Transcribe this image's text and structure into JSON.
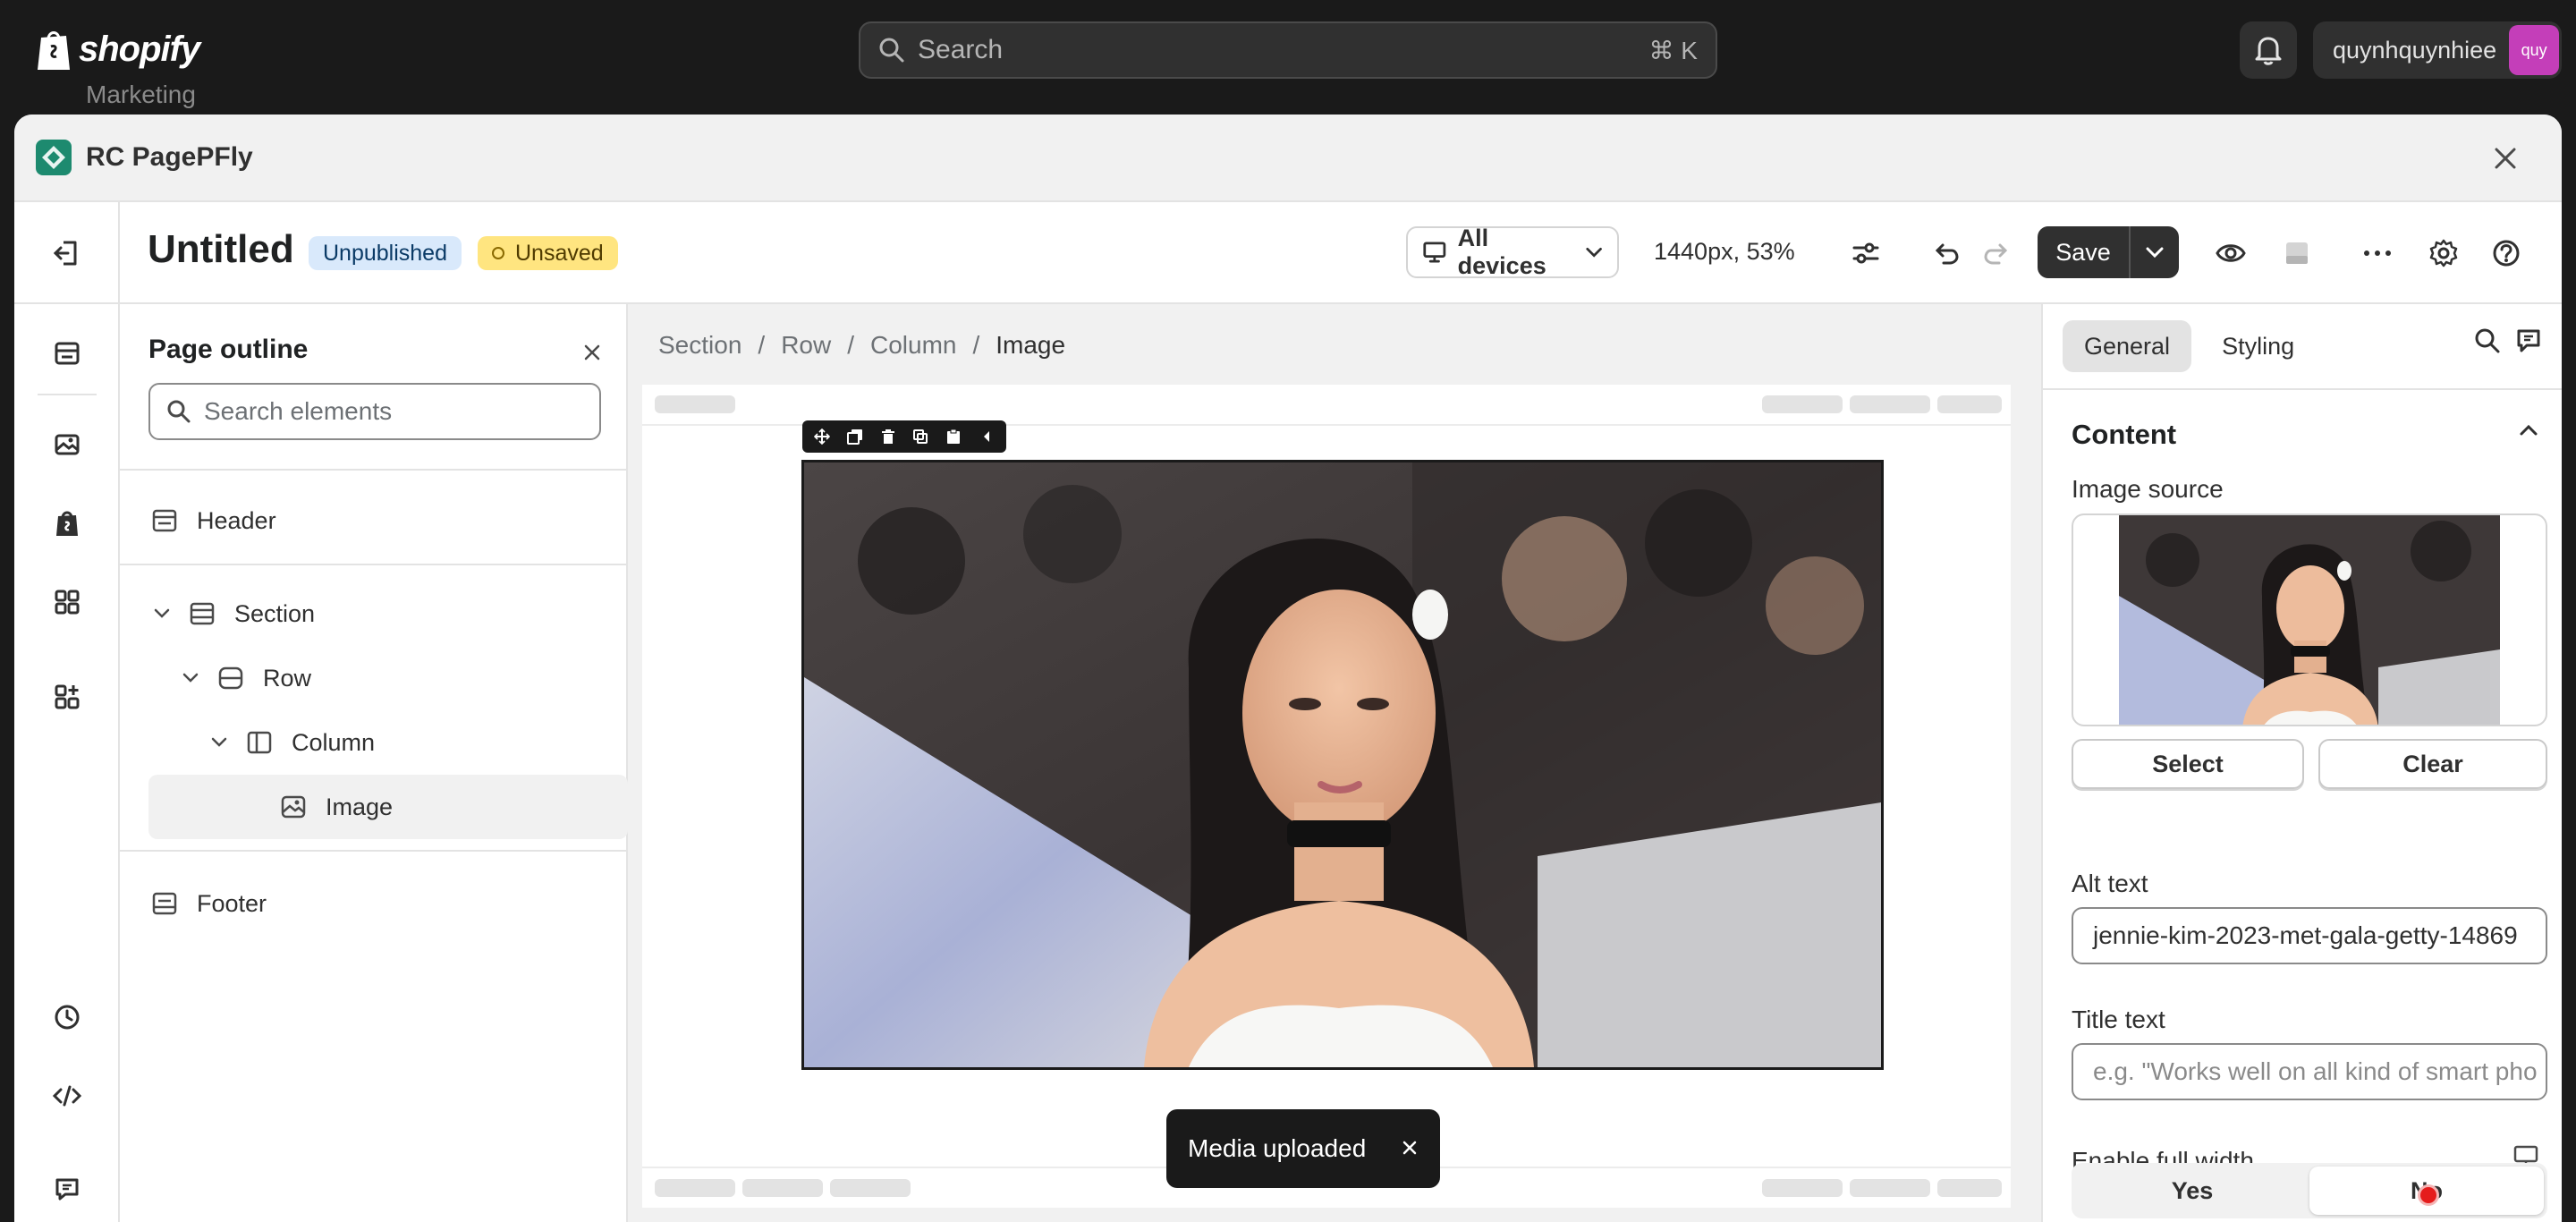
{
  "topbar": {
    "brand": "shopify",
    "behind_text": "Marketing",
    "search_placeholder": "Search",
    "search_shortcut": "⌘ K",
    "account_name": "quynhquynhiee",
    "avatar_initials": "quy"
  },
  "modal": {
    "app_title": "RC PagePFly"
  },
  "editor": {
    "page_title": "Untitled",
    "badges": {
      "status": "Unpublished",
      "save_state": "Unsaved"
    },
    "devices_label": "All devices",
    "zoom_text": "1440px, 53%",
    "save_label": "Save"
  },
  "outline": {
    "title": "Page outline",
    "search_placeholder": "Search elements",
    "items": {
      "header": "Header",
      "section": "Section",
      "row": "Row",
      "column": "Column",
      "image": "Image",
      "footer": "Footer"
    }
  },
  "canvas": {
    "breadcrumb": [
      "Section",
      "Row",
      "Column",
      "Image"
    ],
    "toast": "Media uploaded"
  },
  "inspector": {
    "tabs": [
      "General",
      "Styling"
    ],
    "active_tab": "General",
    "section_title": "Content",
    "image_source_label": "Image source",
    "select_label": "Select",
    "clear_label": "Clear",
    "alt_label": "Alt text",
    "alt_value": "jennie-kim-2023-met-gala-getty-14869",
    "title_label": "Title text",
    "title_placeholder": "e.g. \"Works well on all kind of smart pho",
    "full_width_label": "Enable full width",
    "yes_label": "Yes",
    "no_label": "No",
    "full_width_selected": "No"
  },
  "colors": {
    "topbar_bg": "#1a1a1a",
    "badge_unpublished": "#d9e9fb",
    "badge_unsaved": "#ffe580",
    "save_bg": "#303030",
    "app_icon": "#1d8a6f"
  }
}
